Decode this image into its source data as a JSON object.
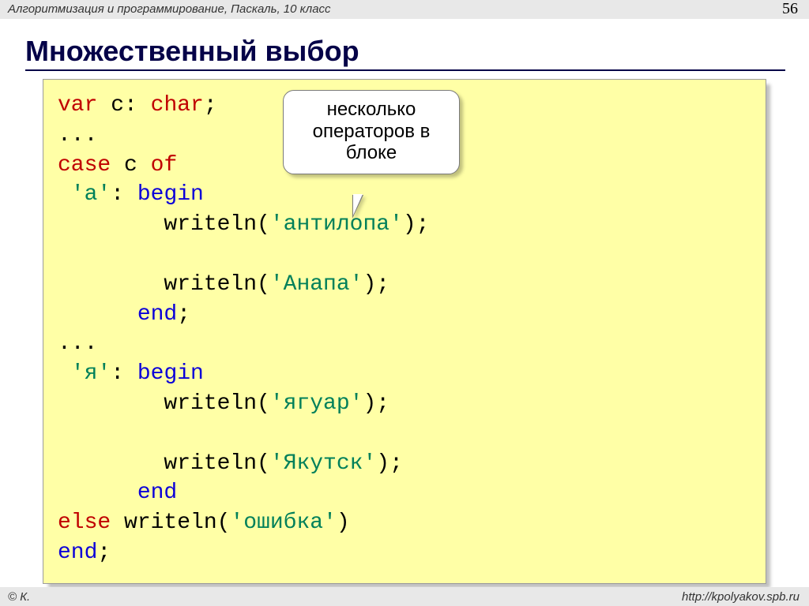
{
  "header": {
    "breadcrumb": "Алгоритмизация и программирование, Паскаль, 10 класс",
    "page_number": "56"
  },
  "title": "Множественный выбор",
  "callout": {
    "line1": "несколько",
    "line2": "операторов в",
    "line3": "блоке"
  },
  "code": {
    "l1_var": "var",
    "l1_c": " c: ",
    "l1_char": "char",
    "l1_semi": ";",
    "l2": "...",
    "l3_case": "case",
    "l3_rest": " c ",
    "l3_of": "of",
    "l4_sp": " ",
    "l4_lit": "'а'",
    "l4_colon": ": ",
    "l4_begin": "begin",
    "l5_sp": "        writeln(",
    "l5_lit": "'антилопа'",
    "l5_end": ");",
    "l7_sp": "        writeln(",
    "l7_lit": "'Анапа'",
    "l7_end": ");",
    "l8_sp": "      ",
    "l8_end": "end",
    "l8_semi": ";",
    "l9": "...",
    "l10_sp": " ",
    "l10_lit": "'я'",
    "l10_colon": ": ",
    "l10_begin": "begin",
    "l11_sp": "        writeln(",
    "l11_lit": "'ягуар'",
    "l11_end": ");",
    "l13_sp": "        writeln(",
    "l13_lit": "'Якутск'",
    "l13_end": ");",
    "l14_sp": "      ",
    "l14_end": "end",
    "l15_else": "else",
    "l15_sp": " writeln(",
    "l15_lit": "'ошибка'",
    "l15_end": ")",
    "l16_end": "end",
    "l16_semi": ";"
  },
  "footer": {
    "left": "© К.",
    "right": "http://kpolyakov.spb.ru"
  }
}
